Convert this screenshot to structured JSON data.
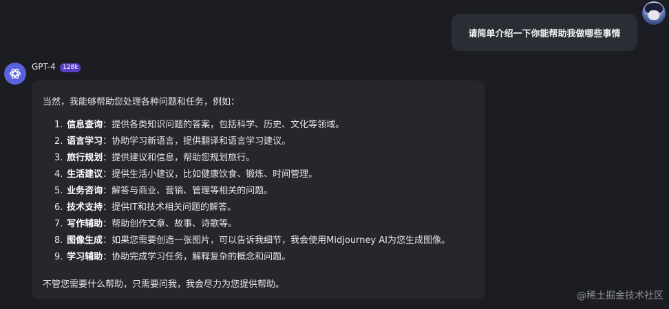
{
  "user_message": "请简单介绍一下你能帮助我做哪些事情",
  "assistant": {
    "name": "GPT-4",
    "badge": "128k",
    "intro": "当然，我能够帮助您处理各种问题和任务，例如：",
    "items": [
      {
        "num": "1.",
        "title": "信息查询",
        "sep": "：",
        "desc": "提供各类知识问题的答案，包括科学、历史、文化等领域。"
      },
      {
        "num": "2.",
        "title": "语言学习",
        "sep": "：",
        "desc": "协助学习新语言，提供翻译和语言学习建议。"
      },
      {
        "num": "3.",
        "title": "旅行规划",
        "sep": "：",
        "desc": "提供建议和信息，帮助您规划旅行。"
      },
      {
        "num": "4.",
        "title": "生活建议",
        "sep": "：",
        "desc": "提供生活小建议，比如健康饮食、锻炼、时间管理。"
      },
      {
        "num": "5.",
        "title": "业务咨询",
        "sep": "：",
        "desc": "解答与商业、营销、管理等相关的问题。"
      },
      {
        "num": "6.",
        "title": "技术支持",
        "sep": "：",
        "desc": "提供IT和技术相关问题的解答。"
      },
      {
        "num": "7.",
        "title": "写作辅助",
        "sep": "：",
        "desc": "帮助创作文章、故事、诗歌等。"
      },
      {
        "num": "8.",
        "title": "图像生成",
        "sep": "：",
        "desc": "如果您需要创造一张图片，可以告诉我细节，我会使用Midjourney AI为您生成图像。"
      },
      {
        "num": "9.",
        "title": "学习辅助",
        "sep": "：",
        "desc": "协助完成学习任务，解释复杂的概念和问题。"
      }
    ],
    "outro": "不管您需要什么帮助，只需要问我，我会尽力为您提供帮助。"
  },
  "watermark": "@稀土掘金技术社区",
  "icons": {
    "user_avatar": "anime-avatar-icon",
    "bot_avatar": "openai-logo-icon"
  }
}
